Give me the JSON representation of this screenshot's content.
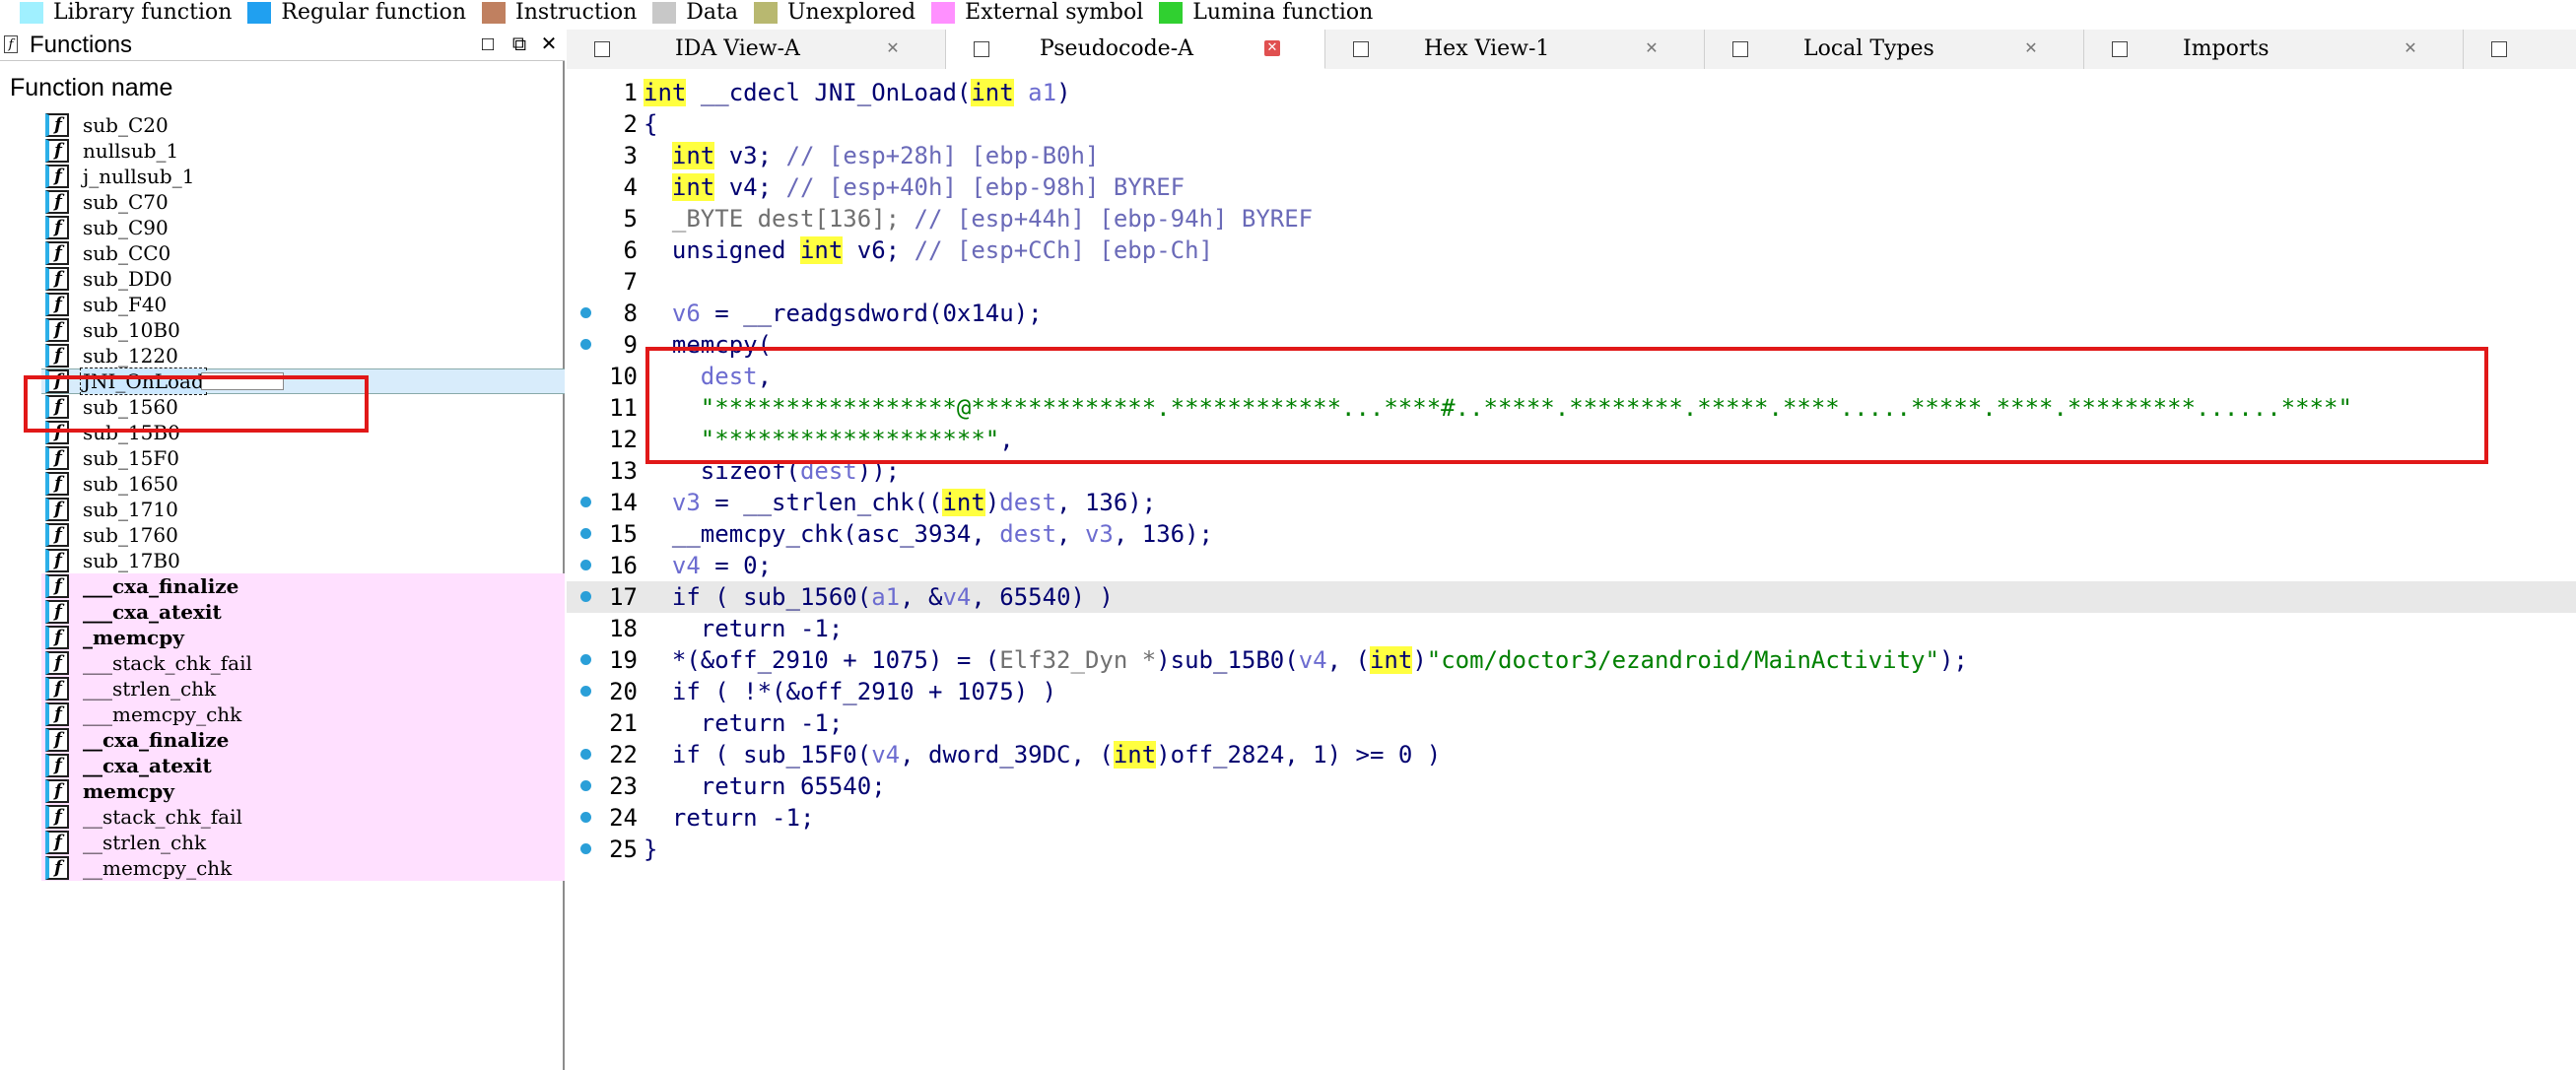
{
  "legend": [
    {
      "label": "Library function",
      "color": "#a0f0ff"
    },
    {
      "label": "Regular function",
      "color": "#20a0f0"
    },
    {
      "label": "Instruction",
      "color": "#c08060"
    },
    {
      "label": "Data",
      "color": "#c8c8c8"
    },
    {
      "label": "Unexplored",
      "color": "#b8b870"
    },
    {
      "label": "External symbol",
      "color": "#ff90ff"
    },
    {
      "label": "Lumina function",
      "color": "#30d030"
    }
  ],
  "functions_panel": {
    "title": "Functions",
    "column_header": "Function name",
    "items": [
      {
        "name": "sub_C20",
        "kind": "regular"
      },
      {
        "name": "nullsub_1",
        "kind": "regular"
      },
      {
        "name": "j_nullsub_1",
        "kind": "regular"
      },
      {
        "name": "sub_C70",
        "kind": "regular"
      },
      {
        "name": "sub_C90",
        "kind": "regular"
      },
      {
        "name": "sub_CC0",
        "kind": "regular"
      },
      {
        "name": "sub_DD0",
        "kind": "regular"
      },
      {
        "name": "sub_F40",
        "kind": "regular"
      },
      {
        "name": "sub_10B0",
        "kind": "regular"
      },
      {
        "name": "sub_1220",
        "kind": "regular"
      },
      {
        "name": "JNI_OnLoad",
        "kind": "selected"
      },
      {
        "name": "sub_1560",
        "kind": "regular"
      },
      {
        "name": "sub_15B0",
        "kind": "regular"
      },
      {
        "name": "sub_15F0",
        "kind": "regular"
      },
      {
        "name": "sub_1650",
        "kind": "regular"
      },
      {
        "name": "sub_1710",
        "kind": "regular"
      },
      {
        "name": "sub_1760",
        "kind": "regular"
      },
      {
        "name": "sub_17B0",
        "kind": "regular"
      },
      {
        "name": "___cxa_finalize",
        "kind": "lib-bold"
      },
      {
        "name": "___cxa_atexit",
        "kind": "lib-bold"
      },
      {
        "name": "_memcpy",
        "kind": "lib-bold"
      },
      {
        "name": "___stack_chk_fail",
        "kind": "lib"
      },
      {
        "name": "___strlen_chk",
        "kind": "lib"
      },
      {
        "name": "___memcpy_chk",
        "kind": "lib"
      },
      {
        "name": "__cxa_finalize",
        "kind": "lib-bold"
      },
      {
        "name": "__cxa_atexit",
        "kind": "lib-bold"
      },
      {
        "name": "memcpy",
        "kind": "lib-bold"
      },
      {
        "name": "__stack_chk_fail",
        "kind": "lib"
      },
      {
        "name": "__strlen_chk",
        "kind": "lib"
      },
      {
        "name": "__memcpy_chk",
        "kind": "lib"
      }
    ]
  },
  "tabs": [
    {
      "label": "IDA View-A",
      "active": false
    },
    {
      "label": "Pseudocode-A",
      "active": true
    },
    {
      "label": "Hex View-1",
      "active": false
    },
    {
      "label": "Local Types",
      "active": false
    },
    {
      "label": "Imports",
      "active": false
    }
  ],
  "code": [
    {
      "n": "1",
      "bp": false,
      "hl": false,
      "tokens": [
        [
          "type",
          "int"
        ],
        [
          "plain",
          " "
        ],
        [
          "kw",
          "__cdecl JNI_OnLoad("
        ],
        [
          "type",
          "int"
        ],
        [
          "plain",
          " "
        ],
        [
          "var",
          "a1"
        ],
        [
          "kw",
          ")"
        ]
      ]
    },
    {
      "n": "2",
      "bp": false,
      "hl": false,
      "tokens": [
        [
          "kw",
          "{"
        ]
      ]
    },
    {
      "n": "3",
      "bp": false,
      "hl": false,
      "tokens": [
        [
          "plain",
          "  "
        ],
        [
          "type",
          "int"
        ],
        [
          "kw",
          " v3; "
        ],
        [
          "cmt",
          "// [esp+28h] [ebp-B0h]"
        ]
      ]
    },
    {
      "n": "4",
      "bp": false,
      "hl": false,
      "tokens": [
        [
          "plain",
          "  "
        ],
        [
          "type",
          "int"
        ],
        [
          "kw",
          " v4; "
        ],
        [
          "cmt",
          "// [esp+40h] [ebp-98h] BYREF"
        ]
      ]
    },
    {
      "n": "5",
      "bp": false,
      "hl": false,
      "tokens": [
        [
          "plain",
          "  "
        ],
        [
          "gray",
          "_BYTE dest[136]; "
        ],
        [
          "cmt",
          "// [esp+44h] [ebp-94h] BYREF"
        ]
      ]
    },
    {
      "n": "6",
      "bp": false,
      "hl": false,
      "tokens": [
        [
          "plain",
          "  "
        ],
        [
          "kw",
          "unsigned "
        ],
        [
          "type",
          "int"
        ],
        [
          "kw",
          " v6; "
        ],
        [
          "cmt",
          "// [esp+CCh] [ebp-Ch]"
        ]
      ]
    },
    {
      "n": "7",
      "bp": false,
      "hl": false,
      "tokens": []
    },
    {
      "n": "8",
      "bp": true,
      "hl": false,
      "tokens": [
        [
          "plain",
          "  "
        ],
        [
          "var",
          "v6"
        ],
        [
          "kw",
          " = __readgsdword(0x14u);"
        ]
      ]
    },
    {
      "n": "9",
      "bp": true,
      "hl": false,
      "tokens": [
        [
          "plain",
          "  "
        ],
        [
          "kw",
          "memcpy("
        ]
      ]
    },
    {
      "n": "10",
      "bp": false,
      "hl": false,
      "tokens": [
        [
          "plain",
          "    "
        ],
        [
          "var",
          "dest"
        ],
        [
          "kw",
          ","
        ]
      ]
    },
    {
      "n": "11",
      "bp": false,
      "hl": false,
      "tokens": [
        [
          "plain",
          "    "
        ],
        [
          "str",
          "\"*****************@*************.************...****#..*****.********.*****.****.....*****.****.*********......****\""
        ]
      ]
    },
    {
      "n": "12",
      "bp": false,
      "hl": false,
      "tokens": [
        [
          "plain",
          "    "
        ],
        [
          "str",
          "\"*******************\""
        ],
        [
          "kw",
          ","
        ]
      ]
    },
    {
      "n": "13",
      "bp": false,
      "hl": false,
      "tokens": [
        [
          "plain",
          "    "
        ],
        [
          "kw",
          "sizeof("
        ],
        [
          "var",
          "dest"
        ],
        [
          "kw",
          "));"
        ]
      ]
    },
    {
      "n": "14",
      "bp": true,
      "hl": false,
      "tokens": [
        [
          "plain",
          "  "
        ],
        [
          "var",
          "v3"
        ],
        [
          "kw",
          " = __strlen_chk(("
        ],
        [
          "type",
          "int"
        ],
        [
          "kw",
          ")"
        ],
        [
          "var",
          "dest"
        ],
        [
          "kw",
          ", 136);"
        ]
      ]
    },
    {
      "n": "15",
      "bp": true,
      "hl": false,
      "tokens": [
        [
          "plain",
          "  "
        ],
        [
          "kw",
          "__memcpy_chk(asc_3934, "
        ],
        [
          "var",
          "dest"
        ],
        [
          "kw",
          ", "
        ],
        [
          "var",
          "v3"
        ],
        [
          "kw",
          ", 136);"
        ]
      ]
    },
    {
      "n": "16",
      "bp": true,
      "hl": false,
      "tokens": [
        [
          "plain",
          "  "
        ],
        [
          "var",
          "v4"
        ],
        [
          "kw",
          " = 0;"
        ]
      ]
    },
    {
      "n": "17",
      "bp": true,
      "hl": true,
      "tokens": [
        [
          "plain",
          "  "
        ],
        [
          "kw",
          "if ( sub_1560("
        ],
        [
          "var",
          "a1"
        ],
        [
          "kw",
          ", &"
        ],
        [
          "var",
          "v4"
        ],
        [
          "kw",
          ", 65540) )"
        ]
      ]
    },
    {
      "n": "18",
      "bp": false,
      "hl": false,
      "tokens": [
        [
          "plain",
          "    "
        ],
        [
          "kw",
          "return -1;"
        ]
      ]
    },
    {
      "n": "19",
      "bp": true,
      "hl": false,
      "tokens": [
        [
          "plain",
          "  "
        ],
        [
          "kw",
          "*(&off_2910 + 1075) = ("
        ],
        [
          "gray",
          "Elf32_Dyn *"
        ],
        [
          "kw",
          ")sub_15B0("
        ],
        [
          "var",
          "v4"
        ],
        [
          "kw",
          ", ("
        ],
        [
          "type",
          "int"
        ],
        [
          "kw",
          ")"
        ],
        [
          "str",
          "\"com/doctor3/ezandroid/MainActivity\""
        ],
        [
          "kw",
          ");"
        ]
      ]
    },
    {
      "n": "20",
      "bp": true,
      "hl": false,
      "tokens": [
        [
          "plain",
          "  "
        ],
        [
          "kw",
          "if ( !*(&off_2910 + 1075) )"
        ]
      ]
    },
    {
      "n": "21",
      "bp": false,
      "hl": false,
      "tokens": [
        [
          "plain",
          "    "
        ],
        [
          "kw",
          "return -1;"
        ]
      ]
    },
    {
      "n": "22",
      "bp": true,
      "hl": false,
      "tokens": [
        [
          "plain",
          "  "
        ],
        [
          "kw",
          "if ( sub_15F0("
        ],
        [
          "var",
          "v4"
        ],
        [
          "kw",
          ", dword_39DC, ("
        ],
        [
          "type",
          "int"
        ],
        [
          "kw",
          ")off_2824, 1) >= 0 )"
        ]
      ]
    },
    {
      "n": "23",
      "bp": true,
      "hl": false,
      "tokens": [
        [
          "plain",
          "    "
        ],
        [
          "kw",
          "return 65540;"
        ]
      ]
    },
    {
      "n": "24",
      "bp": true,
      "hl": false,
      "tokens": [
        [
          "plain",
          "  "
        ],
        [
          "kw",
          "return -1;"
        ]
      ]
    },
    {
      "n": "25",
      "bp": true,
      "hl": false,
      "tokens": [
        [
          "kw",
          "}"
        ]
      ]
    }
  ]
}
